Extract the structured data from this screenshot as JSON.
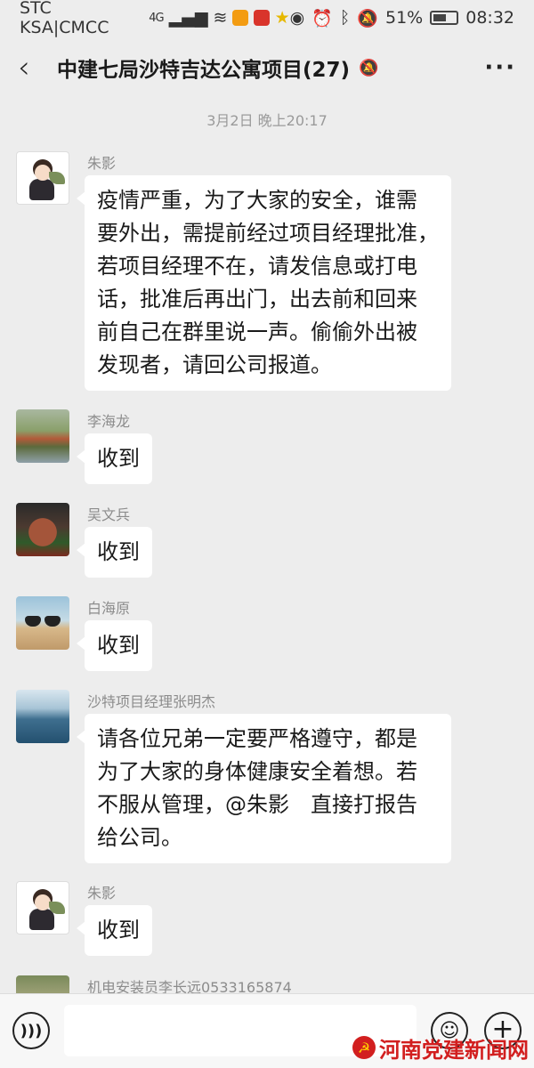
{
  "status_bar": {
    "carrier": "STC KSA|CMCC",
    "network": "4G",
    "battery": "51%",
    "time": "08:32"
  },
  "header": {
    "title": "中建七局沙特吉达公寓项目(27)",
    "back_icon": "chevron-left-icon",
    "mute_icon": "bell-off-icon",
    "more_icon": "more-icon"
  },
  "chat": {
    "timestamp": "3月2日 晚上20:17",
    "messages": [
      {
        "sender": "朱影",
        "lines": [
          "疫情严重，为了大家的安全，谁需",
          "要外出，需提前经过项目经理批准，",
          "若项目经理不在，请发信息或打电",
          "话，批准后再出门，出去前和回来",
          "前自己在群里说一声。偷偷外出被",
          "发现者，请回公司报道。"
        ]
      },
      {
        "sender": "李海龙",
        "text": "收到"
      },
      {
        "sender": "吴文兵",
        "text": "收到"
      },
      {
        "sender": "白海原",
        "text": "收到"
      },
      {
        "sender": "沙特项目经理张明杰",
        "lines": [
          "请各位兄弟一定要严格遵守，都是",
          "为了大家的身体健康安全着想。若",
          "不服从管理，@朱影　直接打报告",
          "给公司。"
        ]
      },
      {
        "sender": "朱影",
        "text": "收到"
      },
      {
        "sender": "机电安装员李长远0533165874"
      }
    ]
  },
  "input_bar": {
    "voice_icon": "voice-icon",
    "emoji_icon": "emoji-icon",
    "plus_icon": "plus-icon"
  },
  "watermark": {
    "text": "河南党建新闻网",
    "color": "#d21f1f"
  }
}
